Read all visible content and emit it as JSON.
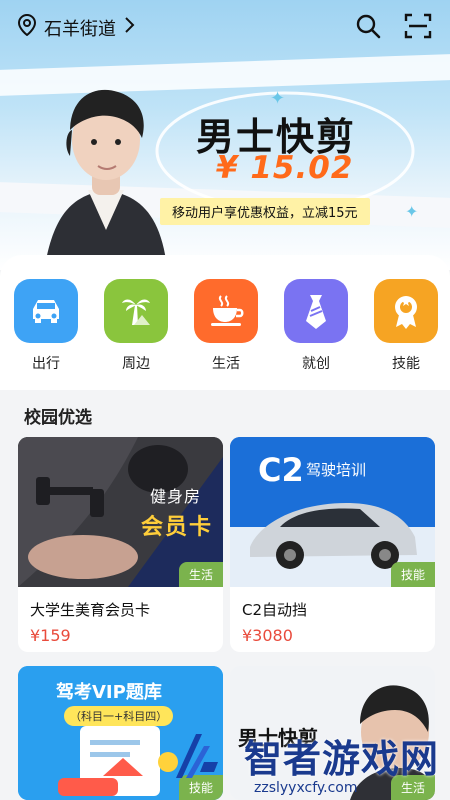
{
  "header": {
    "location": "石羊街道"
  },
  "banner": {
    "title": "男士快剪",
    "price": "¥ 15.02",
    "promo": "移动用户享优惠权益，立减15元"
  },
  "categories": [
    {
      "label": "出行",
      "icon": "car-icon",
      "color": "#3ea3f5"
    },
    {
      "label": "周边",
      "icon": "palm-tree-icon",
      "color": "#8ac53d"
    },
    {
      "label": "生活",
      "icon": "coffee-cup-icon",
      "color": "#ff6b2c"
    },
    {
      "label": "就创",
      "icon": "tie-icon",
      "color": "#7a73f2"
    },
    {
      "label": "技能",
      "icon": "badge-icon",
      "color": "#f6a423"
    }
  ],
  "section": {
    "title": "校园优选"
  },
  "products": [
    {
      "name": "大学生美育会员卡",
      "price": "¥159",
      "tag": "生活",
      "img_line1": "健身房",
      "img_line2": "会员卡"
    },
    {
      "name": "C2自动挡",
      "price": "¥3080",
      "tag": "技能",
      "img_line1": "C2",
      "img_line2": "驾驶培训"
    },
    {
      "name": "",
      "price": "",
      "tag": "技能",
      "img_line1": "驾考VIP题库",
      "img_line2": "（科目一+科目四）"
    },
    {
      "name": "",
      "price": "",
      "tag": "生活",
      "img_line1": "男士快剪",
      "img_line2": ""
    }
  ],
  "watermark": {
    "title": "智者游戏网",
    "url": "zzslyyxcfy.com"
  }
}
